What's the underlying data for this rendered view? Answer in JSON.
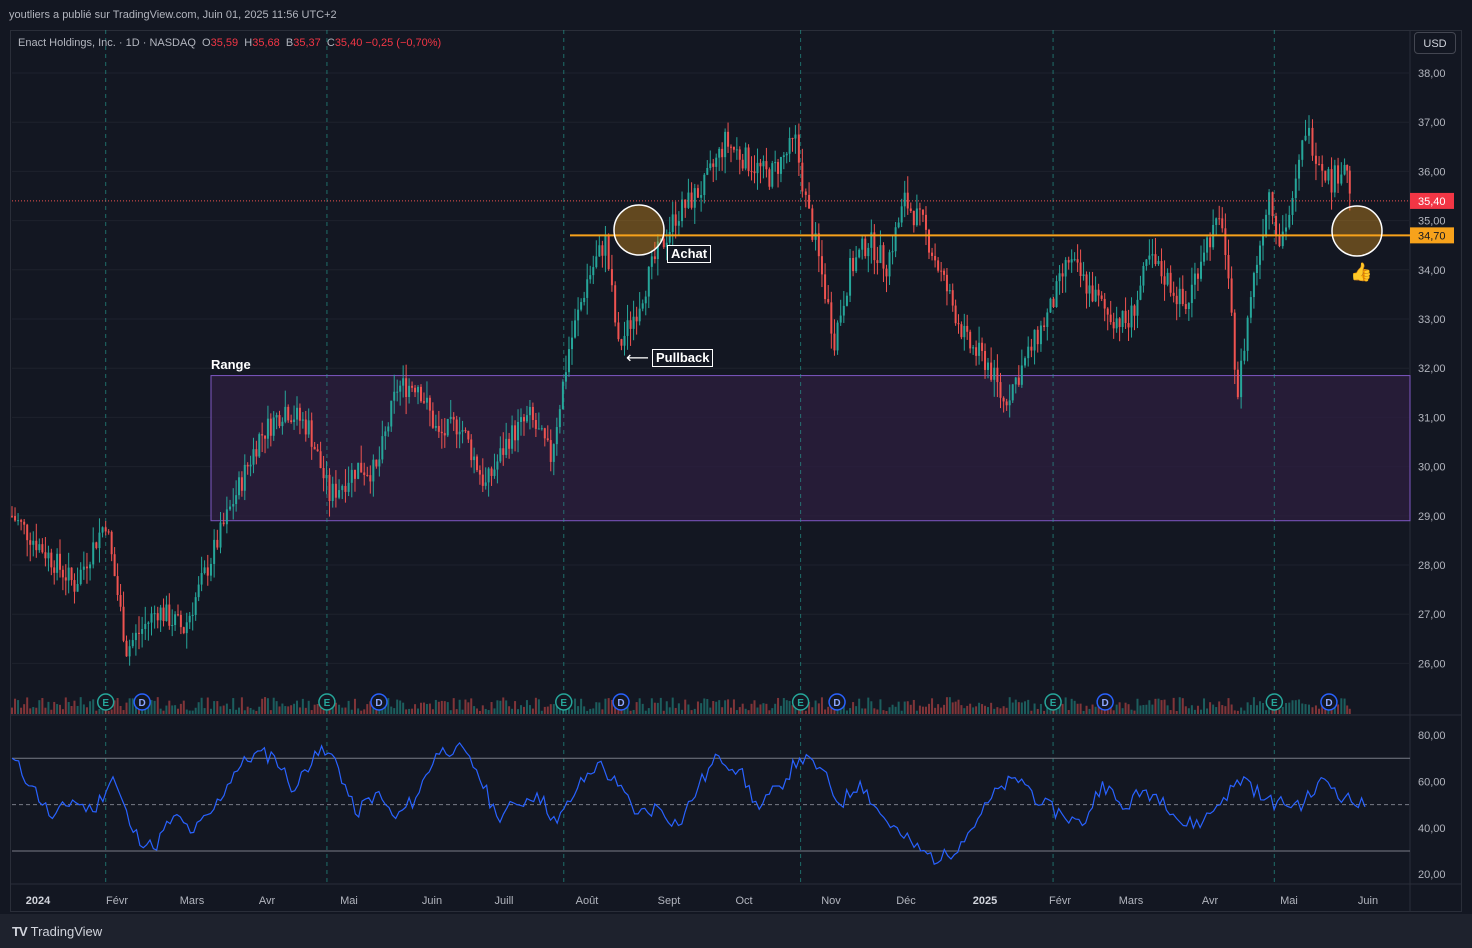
{
  "topbar": {
    "publisher": "youtliers a publié sur TradingView.com, Juin 01, 2025 11:56 UTC+2"
  },
  "legend": {
    "symbol": "Enact Holdings, Inc. · 1D · NASDAQ",
    "o_label": "O",
    "o_value": "35,59",
    "h_label": "H",
    "h_value": "35,68",
    "b_label": "B",
    "b_value": "35,37",
    "c_label": "C",
    "c_value": "35,40 −0,25 (−0,70%)"
  },
  "currency_button": "USD",
  "footer": {
    "brand": "TradingView"
  },
  "colors": {
    "up": "#26a69a",
    "down": "#ef5350",
    "support": "#f7a21b",
    "range_fill": "#2e1f3f",
    "range_border": "#7e57c2",
    "rsi": "#2962ff",
    "earnings": "#26a69a",
    "dividend": "#2962ff"
  },
  "annotations": {
    "range": "Range",
    "pullback": "Pullback",
    "achat": "Achat",
    "pullback_arrow": "⟵",
    "thumb_icon": "👍"
  },
  "chart_data": [
    {
      "type": "candlestick",
      "title": "",
      "price_axis": {
        "ticks": [
          "38,00",
          "37,00",
          "36,00",
          "35,00",
          "34,00",
          "33,00",
          "32,00",
          "31,00",
          "30,00",
          "29,00",
          "28,00",
          "27,00",
          "26,00"
        ],
        "range": [
          25.0,
          38.3
        ]
      },
      "time_axis": {
        "labels": [
          "2024",
          "Févr",
          "Mars",
          "Avr",
          "Mai",
          "Juin",
          "Juill",
          "Août",
          "Sept",
          "Oct",
          "Nov",
          "Déc",
          "2025",
          "Févr",
          "Mars",
          "Avr",
          "Mai",
          "Juin"
        ]
      },
      "last_price": {
        "value": 35.4,
        "label": "35,40"
      },
      "support_level": {
        "value": 34.7,
        "label": "34,70"
      },
      "range_zone": {
        "low": 28.9,
        "high": 31.85
      },
      "events": {
        "earnings": [
          "2024-02-06",
          "2024-05-01",
          "2024-07-31",
          "2024-10-30",
          "2025-02-04",
          "2025-04-30"
        ],
        "dividends": [
          "2024-02-20",
          "2024-05-21",
          "2024-08-22",
          "2024-11-13",
          "2025-02-24",
          "2025-05-21"
        ],
        "earnings_label": "E",
        "dividend_label": "D"
      },
      "series": [
        {
          "date": "2024-01-01",
          "close": 29.0
        },
        {
          "date": "2024-01-15",
          "close": 28.2
        },
        {
          "date": "2024-01-25",
          "close": 27.6
        },
        {
          "date": "2024-02-06",
          "close": 28.9
        },
        {
          "date": "2024-02-14",
          "close": 26.3
        },
        {
          "date": "2024-02-26",
          "close": 27.1
        },
        {
          "date": "2024-03-07",
          "close": 26.7
        },
        {
          "date": "2024-03-15",
          "close": 27.8
        },
        {
          "date": "2024-03-26",
          "close": 29.3
        },
        {
          "date": "2024-04-05",
          "close": 30.6
        },
        {
          "date": "2024-04-15",
          "close": 31.2
        },
        {
          "date": "2024-04-24",
          "close": 30.8
        },
        {
          "date": "2024-05-02",
          "close": 29.4
        },
        {
          "date": "2024-05-13",
          "close": 30.0
        },
        {
          "date": "2024-05-20",
          "close": 29.9
        },
        {
          "date": "2024-05-28",
          "close": 31.6
        },
        {
          "date": "2024-06-05",
          "close": 31.7
        },
        {
          "date": "2024-06-13",
          "close": 30.6
        },
        {
          "date": "2024-06-21",
          "close": 30.9
        },
        {
          "date": "2024-07-01",
          "close": 29.6
        },
        {
          "date": "2024-07-10",
          "close": 30.6
        },
        {
          "date": "2024-07-18",
          "close": 31.0
        },
        {
          "date": "2024-07-26",
          "close": 30.2
        },
        {
          "date": "2024-08-02",
          "close": 32.4
        },
        {
          "date": "2024-08-09",
          "close": 33.8
        },
        {
          "date": "2024-08-16",
          "close": 34.6
        },
        {
          "date": "2024-08-21",
          "close": 32.4
        },
        {
          "date": "2024-08-28",
          "close": 33.2
        },
        {
          "date": "2024-09-04",
          "close": 34.2
        },
        {
          "date": "2024-09-12",
          "close": 35.1
        },
        {
          "date": "2024-09-23",
          "close": 35.7
        },
        {
          "date": "2024-10-01",
          "close": 36.6
        },
        {
          "date": "2024-10-10",
          "close": 36.2
        },
        {
          "date": "2024-10-18",
          "close": 35.9
        },
        {
          "date": "2024-10-28",
          "close": 36.6
        },
        {
          "date": "2024-11-01",
          "close": 35.4
        },
        {
          "date": "2024-11-06",
          "close": 34.2
        },
        {
          "date": "2024-11-12",
          "close": 32.6
        },
        {
          "date": "2024-11-18",
          "close": 34.0
        },
        {
          "date": "2024-11-25",
          "close": 34.6
        },
        {
          "date": "2024-12-02",
          "close": 34.1
        },
        {
          "date": "2024-12-09",
          "close": 35.4
        },
        {
          "date": "2024-12-16",
          "close": 34.9
        },
        {
          "date": "2024-12-23",
          "close": 33.9
        },
        {
          "date": "2025-01-02",
          "close": 32.5
        },
        {
          "date": "2025-01-10",
          "close": 32.1
        },
        {
          "date": "2025-01-16",
          "close": 31.3
        },
        {
          "date": "2025-01-23",
          "close": 32.0
        },
        {
          "date": "2025-02-03",
          "close": 33.2
        },
        {
          "date": "2025-02-10",
          "close": 34.2
        },
        {
          "date": "2025-02-18",
          "close": 33.6
        },
        {
          "date": "2025-02-25",
          "close": 33.1
        },
        {
          "date": "2025-03-05",
          "close": 32.9
        },
        {
          "date": "2025-03-13",
          "close": 34.2
        },
        {
          "date": "2025-03-20",
          "close": 33.8
        },
        {
          "date": "2025-03-27",
          "close": 33.2
        },
        {
          "date": "2025-04-03",
          "close": 34.5
        },
        {
          "date": "2025-04-10",
          "close": 35.0
        },
        {
          "date": "2025-04-16",
          "close": 31.5
        },
        {
          "date": "2025-04-21",
          "close": 33.5
        },
        {
          "date": "2025-04-28",
          "close": 35.6
        },
        {
          "date": "2025-05-02",
          "close": 34.6
        },
        {
          "date": "2025-05-07",
          "close": 35.3
        },
        {
          "date": "2025-05-12",
          "close": 36.9
        },
        {
          "date": "2025-05-16",
          "close": 36.4
        },
        {
          "date": "2025-05-22",
          "close": 35.8
        },
        {
          "date": "2025-05-27",
          "close": 36.2
        },
        {
          "date": "2025-05-30",
          "close": 35.4
        }
      ]
    },
    {
      "type": "line",
      "title": "",
      "y_axis": {
        "ticks": [
          "80,00",
          "60,00",
          "40,00",
          "20,00"
        ],
        "range": [
          15,
          85
        ]
      },
      "levels": {
        "upper": 70,
        "middle": 50,
        "lower": 30
      },
      "series": [
        {
          "values": [
            70,
            58,
            44,
            52,
            47,
            62,
            38,
            31,
            45,
            38,
            48,
            64,
            72,
            71,
            56,
            73,
            70,
            46,
            55,
            44,
            53,
            72,
            75,
            65,
            45,
            50,
            55,
            42,
            57,
            68,
            58,
            46,
            49,
            41,
            58,
            71,
            65,
            48,
            58,
            70,
            66,
            50,
            60,
            46,
            37,
            30,
            26,
            34,
            46,
            58,
            61,
            50,
            46,
            41,
            60,
            48,
            56,
            53,
            41,
            43,
            53,
            62,
            52,
            50,
            51,
            61,
            53,
            49
          ]
        }
      ]
    }
  ]
}
